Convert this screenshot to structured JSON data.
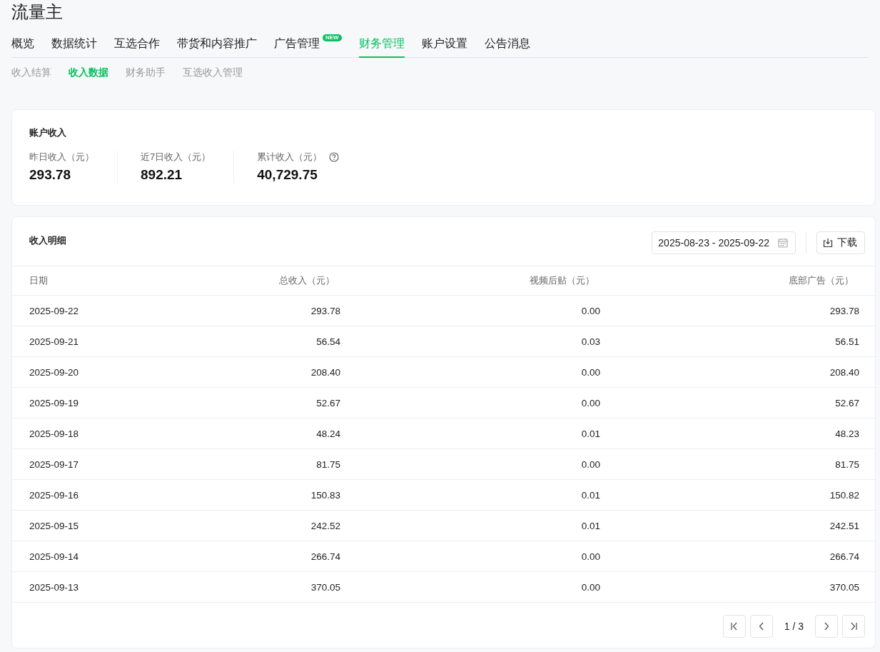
{
  "app_title": "流量主",
  "tabs": [
    {
      "label": "概览",
      "selected": false
    },
    {
      "label": "数据统计",
      "selected": false
    },
    {
      "label": "互选合作",
      "selected": false
    },
    {
      "label": "带货和内容推广",
      "selected": false
    },
    {
      "label": "广告管理",
      "selected": false,
      "badge": "NEW"
    },
    {
      "label": "财务管理",
      "selected": true
    },
    {
      "label": "账户设置",
      "selected": false
    },
    {
      "label": "公告消息",
      "selected": false
    }
  ],
  "subtabs": [
    {
      "label": "收入结算",
      "selected": false
    },
    {
      "label": "收入数据",
      "selected": true
    },
    {
      "label": "财务助手",
      "selected": false
    },
    {
      "label": "互选收入管理",
      "selected": false
    }
  ],
  "account_income": {
    "title": "账户收入",
    "stats": [
      {
        "label": "昨日收入（元）",
        "value": "293.78"
      },
      {
        "label": "近7日收入（元）",
        "value": "892.21"
      },
      {
        "label": "累计收入（元）",
        "value": "40,729.75",
        "help": true
      }
    ]
  },
  "income_detail": {
    "title": "收入明细",
    "date_range": "2025-08-23 - 2025-09-22",
    "download": "下载",
    "columns": [
      "日期",
      "总收入（元）",
      "视频后贴（元）",
      "底部广告（元）"
    ],
    "rows": [
      [
        "2025-09-22",
        "293.78",
        "0.00",
        "293.78"
      ],
      [
        "2025-09-21",
        "56.54",
        "0.03",
        "56.51"
      ],
      [
        "2025-09-20",
        "208.40",
        "0.00",
        "208.40"
      ],
      [
        "2025-09-19",
        "52.67",
        "0.00",
        "52.67"
      ],
      [
        "2025-09-18",
        "48.24",
        "0.01",
        "48.23"
      ],
      [
        "2025-09-17",
        "81.75",
        "0.00",
        "81.75"
      ],
      [
        "2025-09-16",
        "150.83",
        "0.01",
        "150.82"
      ],
      [
        "2025-09-15",
        "242.52",
        "0.01",
        "242.51"
      ],
      [
        "2025-09-14",
        "266.74",
        "0.00",
        "266.74"
      ],
      [
        "2025-09-13",
        "370.05",
        "0.00",
        "370.05"
      ]
    ],
    "pagination": "1 / 3"
  }
}
